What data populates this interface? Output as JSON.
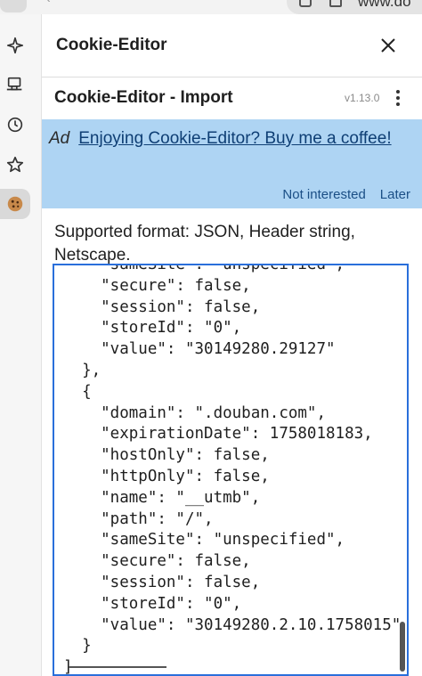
{
  "browser": {
    "url_fragment": "www.do"
  },
  "panel": {
    "title": "Cookie-Editor",
    "subtitle": "Cookie-Editor - Import",
    "version": "v1.13.0"
  },
  "ad": {
    "label": "Ad",
    "link_text": "Enjoying Cookie-Editor? Buy me a coffee!",
    "not_interested": "Not interested",
    "later": "Later",
    "background_color": "#aed4f3"
  },
  "import": {
    "supported_formats": "Supported format: JSON, Header string, Netscape.",
    "code_lines": [
      "    \"sameSite\": \"unspecified\",",
      "    \"secure\": false,",
      "    \"session\": false,",
      "    \"storeId\": \"0\",",
      "    \"value\": \"30149280.29127\"",
      "  },",
      "  {",
      "    \"domain\": \".douban.com\",",
      "    \"expirationDate\": 1758018183,",
      "    \"hostOnly\": false,",
      "    \"httpOnly\": false,",
      "    \"name\": \"__utmb\",",
      "    \"path\": \"/\",",
      "    \"sameSite\": \"unspecified\",",
      "    \"secure\": false,",
      "    \"session\": false,",
      "    \"storeId\": \"0\",",
      "    \"value\": \"30149280.2.10.1758015\"",
      "  }",
      "]"
    ]
  },
  "sidebar_icons": [
    "sparkle-icon",
    "devices-icon",
    "history-icon",
    "star-icon",
    "cookie-icon"
  ],
  "colors": {
    "accent_border": "#2a6fdb",
    "link": "#0e3e74"
  }
}
